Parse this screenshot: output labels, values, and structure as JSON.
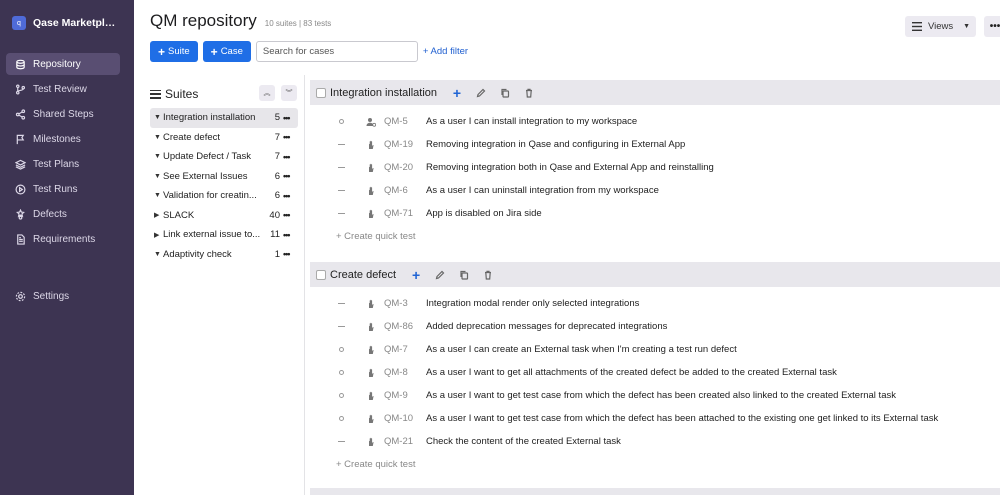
{
  "brand": {
    "name": "Qase Marketpla...",
    "logo_text": "q"
  },
  "nav": {
    "items": [
      {
        "label": "Repository",
        "icon": "database-icon",
        "active": true
      },
      {
        "label": "Test Review",
        "icon": "branch-icon",
        "active": false
      },
      {
        "label": "Shared Steps",
        "icon": "share-icon",
        "active": false
      },
      {
        "label": "Milestones",
        "icon": "flag-icon",
        "active": false
      },
      {
        "label": "Test Plans",
        "icon": "layers-icon",
        "active": false
      },
      {
        "label": "Test Runs",
        "icon": "play-icon",
        "active": false
      },
      {
        "label": "Defects",
        "icon": "bug-icon",
        "active": false
      },
      {
        "label": "Requirements",
        "icon": "document-icon",
        "active": false
      }
    ],
    "settings": {
      "label": "Settings",
      "icon": "gear-icon"
    }
  },
  "header": {
    "title": "QM repository",
    "subtitle": "10 suites | 83 tests",
    "suite_button": "Suite",
    "case_button": "Case",
    "search_placeholder": "Search for cases",
    "add_filter": "+ Add filter",
    "views_label": "Views",
    "more_label": "•••"
  },
  "suites_panel": {
    "title": "Suites",
    "items": [
      {
        "name": "Integration installation",
        "count": "5",
        "expanded": true,
        "active": true
      },
      {
        "name": "Create defect",
        "count": "7",
        "expanded": true,
        "active": false
      },
      {
        "name": "Update Defect / Task",
        "count": "7",
        "expanded": true,
        "active": false
      },
      {
        "name": "See External Issues",
        "count": "6",
        "expanded": true,
        "active": false
      },
      {
        "name": "Validation for creatin...",
        "count": "6",
        "expanded": true,
        "active": false
      },
      {
        "name": "SLACK",
        "count": "40",
        "expanded": false,
        "active": false
      },
      {
        "name": "Link external issue to...",
        "count": "11",
        "expanded": false,
        "active": false
      },
      {
        "name": "Adaptivity check",
        "count": "1",
        "expanded": true,
        "active": false
      }
    ]
  },
  "sections": [
    {
      "title": "Integration installation",
      "cases": [
        {
          "priority": "circle",
          "automation": "user-gear-icon",
          "id": "QM-5",
          "title": "As a user I can install integration to my workspace"
        },
        {
          "priority": "dash",
          "automation": "hand-icon",
          "id": "QM-19",
          "title": "Removing integration in Qase and configuring in External App"
        },
        {
          "priority": "dash",
          "automation": "hand-icon",
          "id": "QM-20",
          "title": "Removing integration both in Qase and External App and reinstalling"
        },
        {
          "priority": "dash",
          "automation": "hand-icon",
          "id": "QM-6",
          "title": "As a user I can uninstall integration from my workspace"
        },
        {
          "priority": "dash",
          "automation": "hand-icon",
          "id": "QM-71",
          "title": "App is disabled on Jira side"
        }
      ],
      "quick_create": "+ Create quick test"
    },
    {
      "title": "Create defect",
      "cases": [
        {
          "priority": "dash",
          "automation": "hand-icon",
          "id": "QM-3",
          "title": "Integration modal render only selected integrations"
        },
        {
          "priority": "dash",
          "automation": "hand-icon",
          "id": "QM-86",
          "title": "Added deprecation messages for deprecated integrations"
        },
        {
          "priority": "circle",
          "automation": "hand-icon",
          "id": "QM-7",
          "title": "As a user I can create an External task when I'm creating a test run defect"
        },
        {
          "priority": "circle",
          "automation": "hand-icon",
          "id": "QM-8",
          "title": "As a user I want to get all attachments of the created defect be added to the created External task"
        },
        {
          "priority": "circle",
          "automation": "hand-icon",
          "id": "QM-9",
          "title": "As a user I want to get test case from which the defect has been created also linked to the created External task"
        },
        {
          "priority": "circle",
          "automation": "hand-icon",
          "id": "QM-10",
          "title": "As a user I want to get test case from which the defect has been attached to the existing one get linked to its External task"
        },
        {
          "priority": "dash",
          "automation": "hand-icon",
          "id": "QM-21",
          "title": "Check the content of the created External task"
        }
      ],
      "quick_create": "+ Create quick test"
    }
  ],
  "colors": {
    "sidebar": "#3d3452",
    "accent": "#1f6ee6",
    "section_header": "#e8e7ec"
  }
}
